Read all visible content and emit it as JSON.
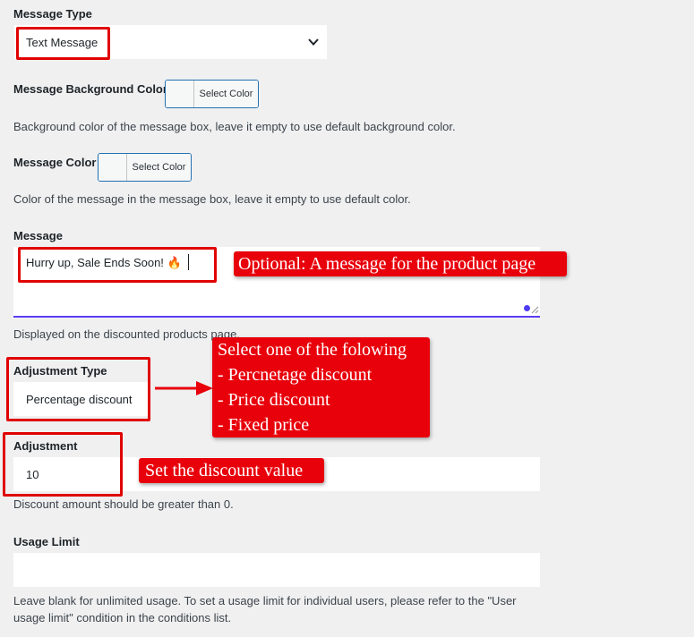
{
  "message_type": {
    "label": "Message Type",
    "selected": "Text Message"
  },
  "message_background_color": {
    "label": "Message Background Color",
    "button_label": "Select Color",
    "description": "Background color of the message box, leave it empty to use default background color."
  },
  "message_color": {
    "label": "Message Color",
    "button_label": "Select Color",
    "description": "Color of the message in the message box, leave it empty to use default color."
  },
  "message": {
    "label": "Message",
    "value": "Hurry up, Sale Ends Soon! 🔥",
    "description": "Displayed on the discounted products page."
  },
  "adjustment_type": {
    "label": "Adjustment Type",
    "selected": "Percentage discount"
  },
  "adjustment": {
    "label": "Adjustment",
    "value": "10",
    "description": "Discount amount should be greater than 0."
  },
  "usage_limit": {
    "label": "Usage Limit",
    "value": "",
    "description_line1": "Leave blank for unlimited usage. To set a usage limit for individual users, please refer to the \"User",
    "description_line2": "usage limit\" condition in the conditions list."
  },
  "annotations": {
    "message_callout": "Optional: A message for the product page",
    "type_callout": {
      "line1": "Select one of the folowing",
      "line2": "- Percnetage discount",
      "line3": "- Price discount",
      "line4": "- Fixed price"
    },
    "adjustment_callout": "Set the discount value"
  },
  "colors": {
    "annotation_red": "#e8000b",
    "focus_underline": "#5b3df5",
    "button_border": "#2271b1"
  }
}
